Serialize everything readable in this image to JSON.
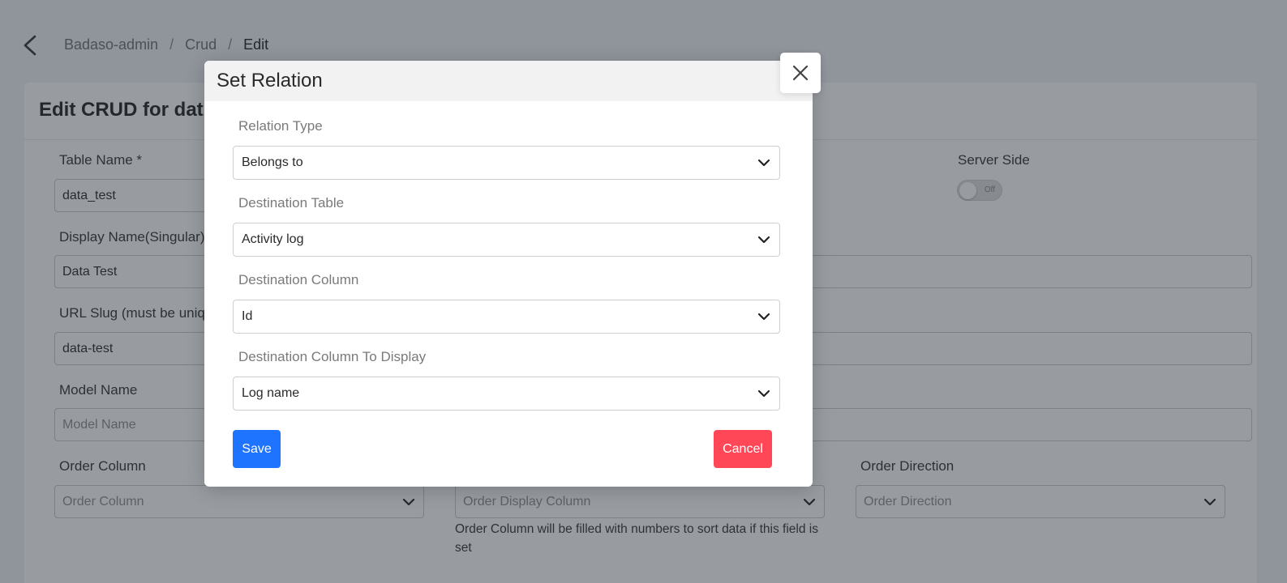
{
  "breadcrumb": {
    "items": [
      "Badaso-admin",
      "Crud",
      "Edit"
    ],
    "separator": "/"
  },
  "page": {
    "title": "Edit CRUD for dat"
  },
  "form": {
    "table_name": {
      "label": "Table Name *",
      "value": "data_test"
    },
    "server_side": {
      "label": "Server Side",
      "toggle_text": "Off"
    },
    "display_name_singular": {
      "label": "Display Name(Singular)",
      "value": "Data Test"
    },
    "url_slug": {
      "label": "URL Slug (must be uniq",
      "value": "data-test"
    },
    "model_name": {
      "label": "Model Name",
      "placeholder": "Model Name"
    },
    "order_column": {
      "label": "Order Column",
      "placeholder": "Order Column"
    },
    "order_display_column": {
      "placeholder": "Order Display Column",
      "hint": "Order Column will be filled with numbers to sort data if this field is set"
    },
    "order_direction": {
      "label": "Order Direction",
      "placeholder": "Order Direction"
    }
  },
  "modal": {
    "title": "Set Relation",
    "fields": [
      {
        "label": "Relation Type",
        "value": "Belongs to"
      },
      {
        "label": "Destination Table",
        "value": "Activity log"
      },
      {
        "label": "Destination Column",
        "value": "Id"
      },
      {
        "label": "Destination Column To Display",
        "value": "Log name"
      }
    ],
    "save_label": "Save",
    "cancel_label": "Cancel"
  },
  "colors": {
    "primary": "#1f74ff",
    "danger": "#ff4757",
    "overlay": "rgba(40,48,58,0.48)"
  },
  "icons": {
    "back": "chevron-left-icon",
    "close": "close-icon",
    "dropdown": "chevron-down-icon"
  }
}
